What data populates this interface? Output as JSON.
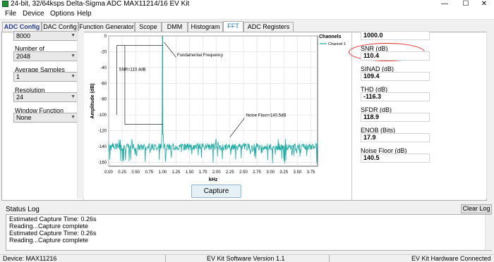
{
  "window": {
    "title": "24-bit, 32/64ksps Delta-Sigma ADC MAX11214/16 EV Kit",
    "minimize": "—",
    "maximize": "☐",
    "close": "✕"
  },
  "menu": [
    "File",
    "Device",
    "Options",
    "Help"
  ],
  "tabs": [
    "ADC Config",
    "DAC Config",
    "Function Generator",
    "Scope",
    "DMM",
    "Histogram",
    "FFT",
    "ADC Registers"
  ],
  "active_tab": "FFT",
  "left_panel": {
    "top_value": "8000",
    "number_of_label": "Number of",
    "number_of_value": "2048",
    "avg_label": "Average Samples",
    "avg_value": "1",
    "res_label": "Resolution",
    "res_value": "24",
    "window_label": "Window Function",
    "window_value": "None"
  },
  "right_panel": {
    "top_value": "1000.0",
    "metrics": [
      {
        "label": "SNR (dB)",
        "value": "110.4"
      },
      {
        "label": "SINAD (dB)",
        "value": "109.4"
      },
      {
        "label": "THD (dB)",
        "value": "-116.3"
      },
      {
        "label": "SFDR (dB)",
        "value": "118.9"
      },
      {
        "label": "ENOB (Bits)",
        "value": "17.9"
      },
      {
        "label": "Noise Floor (dB)",
        "value": "140.5"
      }
    ]
  },
  "capture_label": "Capture",
  "status_log": {
    "title": "Status Log",
    "clear_label": "Clear Log",
    "lines": [
      "Estimated Capture Time: 0.26s",
      "Reading...Capture complete",
      "Estimated Capture Time: 0.26s",
      "Reading...Capture complete"
    ]
  },
  "status_bar": {
    "device": "Device: MAX11216",
    "version": "EV Kit Software Version 1.1",
    "hardware": "EV Kit Hardware Connected"
  },
  "chart_data": {
    "type": "line",
    "xlabel": "kHz",
    "ylabel": "Amplitude (dB)",
    "xlim": [
      0,
      3.875
    ],
    "ylim": [
      -165,
      0
    ],
    "x_ticks": [
      "0.00",
      "0.25",
      "0.50",
      "0.75",
      "1.00",
      "1.25",
      "1.50",
      "1.75",
      "2.00",
      "2.25",
      "2.50",
      "2.75",
      "3.00",
      "3.25",
      "3.50",
      "3.75"
    ],
    "y_ticks": [
      "0",
      "-20",
      "-40",
      "-60",
      "-80",
      "-100",
      "-120",
      "-140",
      "-160"
    ],
    "grid": true,
    "legend_title": "Channels",
    "series": [
      {
        "name": "Channel 1",
        "color": "#17a8a0"
      }
    ],
    "fundamental": {
      "x": 1.0,
      "y": 0
    },
    "noise_floor_db": -140.5,
    "annotations": [
      "Fundamental Frequency",
      "Noise Floor=140.5dB",
      "SNR=110.4dB"
    ]
  }
}
